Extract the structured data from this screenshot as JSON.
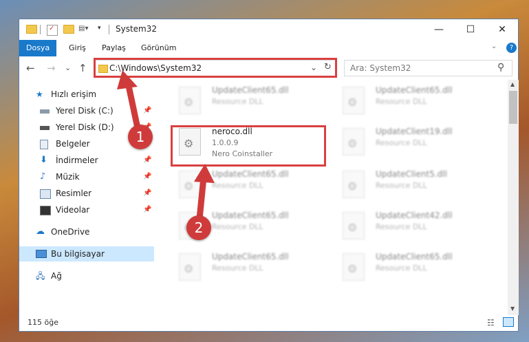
{
  "window": {
    "title": "System32",
    "controls": {
      "minimize": "—",
      "maximize": "☐",
      "close": "✕"
    }
  },
  "ribbon": {
    "tabs": [
      "Dosya",
      "Giriş",
      "Paylaş",
      "Görünüm"
    ],
    "active_tab": "Dosya"
  },
  "nav": {
    "back": "←",
    "forward": "→",
    "recent": "⌄",
    "up": "↑",
    "address": "C:\\Windows\\System32",
    "search_placeholder": "Ara: System32",
    "refresh": "↻",
    "dropdown": "⌄",
    "search_icon": "⚲"
  },
  "sidebar": {
    "items": [
      {
        "label": "Hızlı erişim",
        "icon": "star-icon",
        "pinned": false
      },
      {
        "label": "Yerel Disk (C:)",
        "icon": "drive-icon",
        "pinned": true
      },
      {
        "label": "Yerel Disk (D:)",
        "icon": "drive-icon",
        "pinned": true
      },
      {
        "label": "Belgeler",
        "icon": "documents-icon",
        "pinned": true
      },
      {
        "label": "İndirmeler",
        "icon": "download-icon",
        "pinned": true
      },
      {
        "label": "Müzik",
        "icon": "music-icon",
        "pinned": true
      },
      {
        "label": "Resimler",
        "icon": "pictures-icon",
        "pinned": true
      },
      {
        "label": "Videolar",
        "icon": "video-icon",
        "pinned": true
      },
      {
        "label": "OneDrive",
        "icon": "cloud-icon",
        "pinned": false
      },
      {
        "label": "Bu bilgisayar",
        "icon": "computer-icon",
        "pinned": false
      },
      {
        "label": "Ağ",
        "icon": "network-icon",
        "pinned": false
      }
    ]
  },
  "files": {
    "left_column": [
      {
        "name": "UpdateClient65.dll",
        "desc": "Resource DLL"
      },
      {
        "name": "neroco.dll",
        "version": "1.0.0.9",
        "desc": "Nero Coinstaller"
      },
      {
        "name": "UpdateClient65.dll",
        "desc": "Resource DLL"
      },
      {
        "name": "UpdateClient65.dll",
        "desc": "Resource DLL"
      },
      {
        "name": "UpdateClient65.dll",
        "desc": "Resource DLL"
      }
    ],
    "right_column": [
      {
        "name": "UpdateClient65.dll",
        "desc": "Resource DLL"
      },
      {
        "name": "UpdateClient19.dll",
        "desc": "Resource DLL"
      },
      {
        "name": "UpdateClient5.dll",
        "desc": "Resource DLL"
      },
      {
        "name": "UpdateClient42.dll",
        "desc": "Resource DLL"
      },
      {
        "name": "UpdateClient65.dll",
        "desc": "Resource DLL"
      }
    ]
  },
  "status": {
    "item_count": "115 öğe"
  },
  "callouts": {
    "one": "1",
    "two": "2",
    "color": "#cf3b3b"
  },
  "colors": {
    "accent": "#1979ca",
    "highlight": "#d94040"
  }
}
